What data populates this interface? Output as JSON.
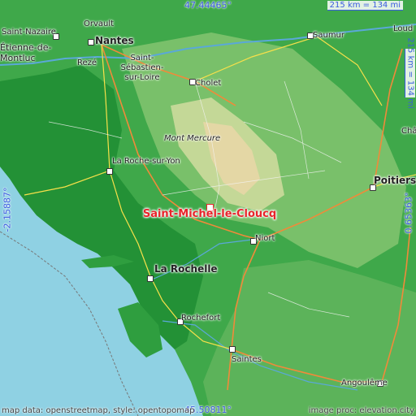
{
  "map": {
    "place_label": "Saint-Michel-le-Cloucq",
    "coords": {
      "top": "47.44465°",
      "bottom": "45.50811°",
      "left": "-2.15887°",
      "right": "0.65363°"
    },
    "scale": {
      "top": "215 km = 134 mi",
      "right": "215 km = 134 mi"
    },
    "attribution": {
      "left": "map data: openstreetmap, style: opentopomap",
      "right": "image proc: elevation.city"
    },
    "places": [
      {
        "name": "Saint-Nazaire"
      },
      {
        "name": "Orvault"
      },
      {
        "name": "Nantes"
      },
      {
        "name": "Étienne-de-Montluc"
      },
      {
        "name": "Rezé"
      },
      {
        "name": "Saint-Sébastien-sur-Loire"
      },
      {
        "name": "Saumur"
      },
      {
        "name": "Cholet"
      },
      {
        "name": "Mont Mercure"
      },
      {
        "name": "La Roche-sur-Yon"
      },
      {
        "name": "Poitiers"
      },
      {
        "name": "Niort"
      },
      {
        "name": "La Rochelle"
      },
      {
        "name": "Rochefort"
      },
      {
        "name": "Saintes"
      },
      {
        "name": "Angoulême"
      },
      {
        "name": "Loud"
      },
      {
        "name": "Châ"
      }
    ],
    "colors": {
      "sea": "#8fd1e3",
      "lowland": "#2f9e3f",
      "midland": "#7cc36b",
      "upland": "#c7d99a",
      "highland": "#e7d9a8",
      "marker": "#e8242b",
      "coord_text": "#3a5be0"
    }
  }
}
